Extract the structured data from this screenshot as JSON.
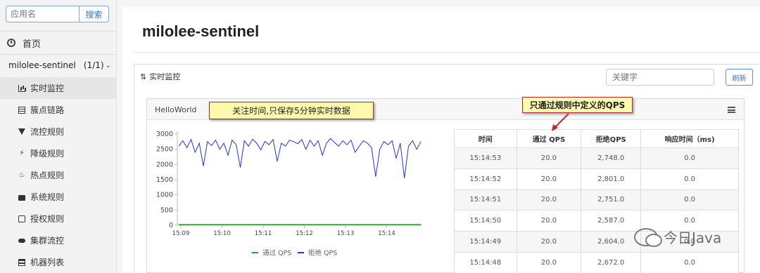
{
  "sidebar": {
    "search_placeholder": "应用名",
    "search_button": "搜索",
    "home_label": "首页",
    "app_name": "milolee-sentinel",
    "app_count": "(1/1)",
    "items": [
      {
        "label": "实时监控",
        "icon": "bar-chart-icon",
        "active": true
      },
      {
        "label": "簇点链路",
        "icon": "list-icon"
      },
      {
        "label": "流控规则",
        "icon": "filter-icon"
      },
      {
        "label": "降级规则",
        "icon": "flash-icon"
      },
      {
        "label": "热点规则",
        "icon": "fire-icon"
      },
      {
        "label": "系统规则",
        "icon": "lock-icon"
      },
      {
        "label": "授权规则",
        "icon": "check-square-icon"
      },
      {
        "label": "集群流控",
        "icon": "cloud-icon"
      },
      {
        "label": "机器列表",
        "icon": "server-icon"
      }
    ]
  },
  "main": {
    "title": "milolee-sentinel",
    "panel_title": "实时监控",
    "keyword_placeholder": "关键字",
    "refresh_button": "刷新"
  },
  "card": {
    "title": "HelloWorld"
  },
  "annotations": {
    "note1": "关注时间,只保存5分钟实时数据",
    "note2": "只通过规则中定义的QPS"
  },
  "table": {
    "headers": [
      "时间",
      "通过 QPS",
      "拒绝QPS",
      "响应时间（ms)"
    ],
    "rows": [
      [
        "15:14:53",
        "20.0",
        "2,748.0",
        "0.0"
      ],
      [
        "15:14:52",
        "20.0",
        "2,801.0",
        "0.0"
      ],
      [
        "15:14:51",
        "20.0",
        "2,751.0",
        "0.0"
      ],
      [
        "15:14:50",
        "20.0",
        "2,587.0",
        "0.0"
      ],
      [
        "15:14:49",
        "20.0",
        "2,604.0",
        "0.0"
      ],
      [
        "15:14:48",
        "20.0",
        "2,672.0",
        "0.0"
      ]
    ]
  },
  "watermark": "今日Java",
  "chart_data": {
    "type": "line",
    "title": "",
    "xlabel": "",
    "ylabel": "",
    "x_ticks": [
      "15:09",
      "15:10",
      "15:11",
      "15:12",
      "15:13",
      "15:14"
    ],
    "y_ticks": [
      0,
      500,
      1000,
      1500,
      2000,
      2500,
      3000
    ],
    "ylim": [
      0,
      3000
    ],
    "legend_position": "bottom",
    "series": [
      {
        "name": "通过 QPS",
        "color": "#2ca02c",
        "values": [
          20,
          20,
          20,
          20,
          20,
          20,
          20,
          20,
          20,
          20,
          20,
          20,
          20,
          20,
          20,
          20,
          20,
          20,
          20,
          20,
          20,
          20,
          20,
          20,
          20,
          20,
          20,
          20,
          20,
          20,
          20,
          20,
          20,
          20,
          20,
          20,
          20,
          20,
          20,
          20,
          20,
          20,
          20,
          20,
          20,
          20,
          20,
          20,
          20,
          20,
          20,
          20,
          20,
          20,
          20,
          20,
          20,
          20,
          20,
          20
        ]
      },
      {
        "name": "拒绝 QPS",
        "color": "#2233dd",
        "values": [
          2600,
          2780,
          2550,
          2820,
          2400,
          2700,
          1950,
          2750,
          2620,
          2800,
          2500,
          2700,
          2300,
          2800,
          2650,
          1900,
          2780,
          2600,
          2830,
          2700,
          2480,
          2760,
          2650,
          2820,
          2100,
          2700,
          2600,
          2800,
          2750,
          2680,
          2820,
          2500,
          2800,
          2600,
          2780,
          2300,
          2700,
          2850,
          2720,
          2600,
          2780,
          2650,
          2800,
          2400,
          2600,
          2780,
          2700,
          2550,
          1600,
          2500,
          2750,
          2650,
          2780,
          2200,
          2700,
          1550,
          2600,
          2780,
          2500,
          2750
        ]
      }
    ]
  }
}
